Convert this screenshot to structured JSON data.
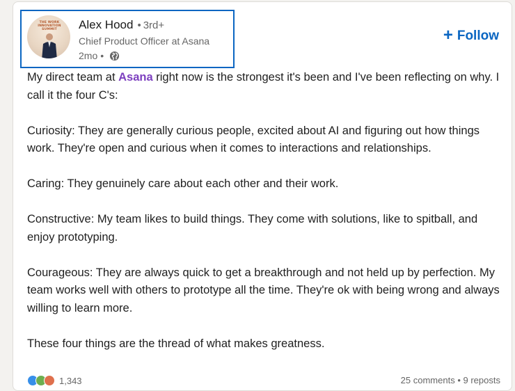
{
  "post": {
    "author": {
      "name": "Alex Hood",
      "separator": "•",
      "degree": "3rd+",
      "headline": "Chief Product Officer at Asana",
      "time": "2mo",
      "time_separator": "•",
      "visibility_icon": "globe-icon",
      "avatar_event_text": "THE WORK INNOVATION SUMMIT"
    },
    "follow_label": "Follow",
    "follow_icon": "plus-icon",
    "body": {
      "intro_before": "My direct team at ",
      "mention": "Asana",
      "intro_after": " right now is the strongest it's been and I've been reflecting on why. I call it the four C's:",
      "curiosity": "Curiosity: They are generally curious people, excited about AI and figuring out how things work. They're open and curious when it comes to interactions and relationships.",
      "caring": "Caring: They genuinely care about each other and their work.",
      "constructive": "Constructive: My team likes to build things. They come with solutions, like to spitball, and enjoy prototyping.",
      "courageous": "Courageous: They are always quick to get a breakthrough and not held up by perfection. My team works well with others to prototype all the time. They're ok with being wrong and always willing to learn more.",
      "closing": "These four things are the thread of what makes greatness."
    },
    "social": {
      "reaction_icons": [
        "like-icon",
        "support-icon",
        "love-icon"
      ],
      "reaction_count": "1,343",
      "comments": "25 comments",
      "separator": "•",
      "reposts": "9 reposts"
    }
  },
  "colors": {
    "accent": "#0a66c2",
    "mention": "#7c3fbf",
    "background": "#f3f2ef",
    "card": "#ffffff"
  }
}
